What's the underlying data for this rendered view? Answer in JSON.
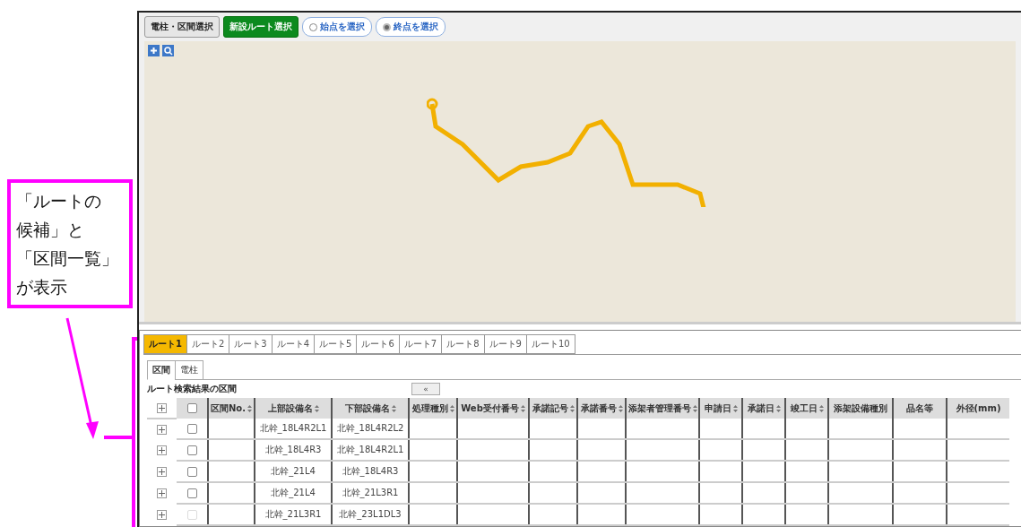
{
  "callout": {
    "lines": [
      "「ルートの",
      "候補」と",
      "「区間一覧」",
      "が表示"
    ]
  },
  "toolbar": {
    "buttons": [
      {
        "label": "電柱・区間選択",
        "kind": "plain"
      },
      {
        "label": "新設ルート選択",
        "kind": "primary"
      }
    ],
    "radios": [
      {
        "label": "始点を選択",
        "selected": false
      },
      {
        "label": "終点を選択",
        "selected": true
      }
    ]
  },
  "route_tabs": [
    {
      "label": "ルート1",
      "selected": true
    },
    {
      "label": "ルート2",
      "selected": false
    },
    {
      "label": "ルート3",
      "selected": false
    },
    {
      "label": "ルート4",
      "selected": false
    },
    {
      "label": "ルート5",
      "selected": false
    },
    {
      "label": "ルート6",
      "selected": false
    },
    {
      "label": "ルート7",
      "selected": false
    },
    {
      "label": "ルート8",
      "selected": false
    },
    {
      "label": "ルート9",
      "selected": false
    },
    {
      "label": "ルート10",
      "selected": false
    }
  ],
  "sub_tabs": [
    {
      "label": "区間",
      "selected": true
    },
    {
      "label": "電柱",
      "selected": false
    }
  ],
  "section_title": "ルート検索結果の区間",
  "collapse_button": "«",
  "table": {
    "select_all": {
      "checked": false
    },
    "columns": [
      {
        "label": "区間No.",
        "sortable": true
      },
      {
        "label": "上部設備名",
        "sortable": true
      },
      {
        "label": "下部設備名",
        "sortable": true
      },
      {
        "label": "処理種別",
        "sortable": true
      },
      {
        "label": "Web受付番号",
        "sortable": true
      },
      {
        "label": "承諾記号",
        "sortable": true
      },
      {
        "label": "承諾番号",
        "sortable": true
      },
      {
        "label": "添架者管理番号",
        "sortable": true
      },
      {
        "label": "申請日",
        "sortable": true
      },
      {
        "label": "承諾日",
        "sortable": true
      },
      {
        "label": "竣工日",
        "sortable": true
      },
      {
        "label": "添架設備種別",
        "sortable": false
      },
      {
        "label": "品名等",
        "sortable": false
      },
      {
        "label": "外径(mm)",
        "sortable": false
      }
    ],
    "rows": [
      {
        "checked": false,
        "disabled": false,
        "upper": "北幹_18L4R2L1",
        "lower": "北幹_18L4R2L2"
      },
      {
        "checked": false,
        "disabled": false,
        "upper": "北幹_18L4R3",
        "lower": "北幹_18L4R2L1"
      },
      {
        "checked": false,
        "disabled": false,
        "upper": "北幹_21L4",
        "lower": "北幹_18L4R3"
      },
      {
        "checked": false,
        "disabled": false,
        "upper": "北幹_21L4",
        "lower": "北幹_21L3R1"
      },
      {
        "checked": false,
        "disabled": true,
        "upper": "北幹_21L3R1",
        "lower": "北幹_23L1DL3"
      }
    ]
  }
}
